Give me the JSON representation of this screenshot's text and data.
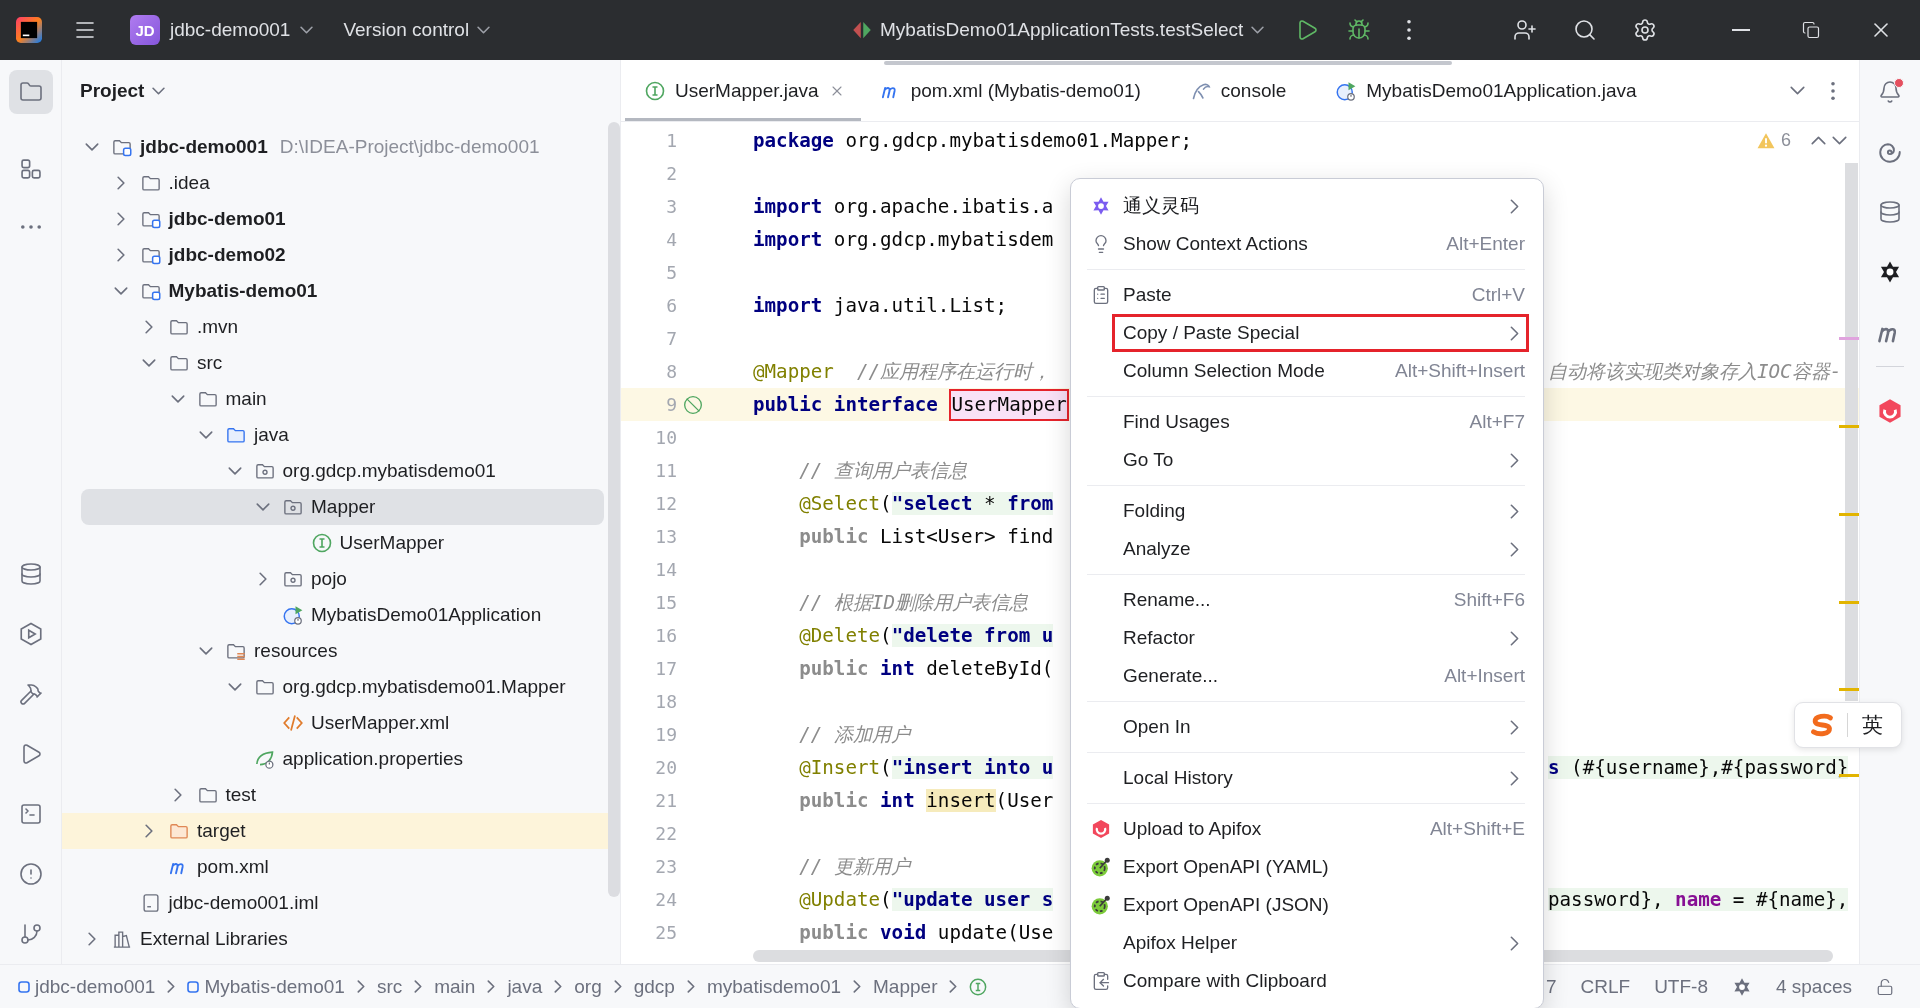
{
  "title_bar": {
    "badge": "JD",
    "project": "jdbc-demo001",
    "vcs": "Version control",
    "run_configuration": "MybatisDemo01ApplicationTests.testSelect"
  },
  "left_toolbar": {
    "top": [
      {
        "kind": "project",
        "selected": true
      },
      {
        "kind": "structure",
        "selected": false
      },
      {
        "kind": "more",
        "selected": false
      }
    ],
    "bottom": [
      {
        "kind": "database",
        "selected": false
      },
      {
        "kind": "services",
        "selected": false
      },
      {
        "kind": "build",
        "selected": false
      },
      {
        "kind": "run",
        "selected": false
      },
      {
        "kind": "terminal",
        "selected": false
      },
      {
        "kind": "problems",
        "selected": false
      },
      {
        "kind": "git",
        "selected": false
      }
    ]
  },
  "project_panel": {
    "title": "Project",
    "tree": [
      {
        "label": "jdbc-demo001",
        "detail": "D:\\IDEA-Project\\jdbc-demo001",
        "kind": "module",
        "expanded": true,
        "selected": false,
        "children": [
          {
            "label": ".idea",
            "kind": "folder",
            "expanded": false,
            "selected": false
          },
          {
            "label": "jdbc-demo01",
            "kind": "module",
            "expanded": false,
            "selected": false
          },
          {
            "label": "jdbc-demo02",
            "kind": "module",
            "expanded": false,
            "selected": false
          },
          {
            "label": "Mybatis-demo01",
            "kind": "module",
            "expanded": true,
            "selected": false,
            "children": [
              {
                "label": ".mvn",
                "kind": "folder",
                "expanded": false,
                "selected": false
              },
              {
                "label": "src",
                "kind": "folder",
                "expanded": true,
                "selected": false,
                "children": [
                  {
                    "label": "main",
                    "kind": "folder",
                    "expanded": true,
                    "selected": false,
                    "children": [
                      {
                        "label": "java",
                        "kind": "source",
                        "expanded": true,
                        "selected": false,
                        "children": [
                          {
                            "label": "org.gdcp.mybatisdemo01",
                            "kind": "package",
                            "expanded": true,
                            "selected": false,
                            "children": [
                              {
                                "label": "Mapper",
                                "kind": "package",
                                "expanded": true,
                                "selected": true,
                                "children": [
                                  {
                                    "label": "UserMapper",
                                    "kind": "interface",
                                    "selected": false
                                  }
                                ]
                              },
                              {
                                "label": "pojo",
                                "kind": "package",
                                "expanded": false,
                                "selected": false
                              },
                              {
                                "label": "MybatisDemo01Application",
                                "kind": "application",
                                "selected": false
                              }
                            ]
                          }
                        ]
                      },
                      {
                        "label": "resources",
                        "kind": "resources",
                        "expanded": true,
                        "selected": false,
                        "children": [
                          {
                            "label": "org.gdcp.mybatisdemo01.Mapper",
                            "kind": "folder",
                            "expanded": true,
                            "selected": false,
                            "children": [
                              {
                                "label": "UserMapper.xml",
                                "kind": "xml",
                                "selected": false
                              }
                            ]
                          },
                          {
                            "label": "application.properties",
                            "kind": "properties",
                            "selected": false
                          }
                        ]
                      }
                    ]
                  },
                  {
                    "label": "test",
                    "kind": "folder",
                    "expanded": false,
                    "selected": false
                  }
                ]
              },
              {
                "label": "target",
                "kind": "excluded",
                "expanded": false,
                "selected": false
              },
              {
                "label": "pom.xml",
                "kind": "maven",
                "selected": false
              }
            ]
          },
          {
            "label": "jdbc-demo001.iml",
            "kind": "iml",
            "selected": false
          }
        ]
      },
      {
        "label": "External Libraries",
        "kind": "libraries",
        "expanded": false,
        "selected": false
      }
    ]
  },
  "editor_tabs": [
    {
      "label": "UserMapper.java",
      "kind": "interface",
      "selected": true,
      "closable": true
    },
    {
      "label": "pom.xml (Mybatis-demo01)",
      "kind": "maven",
      "selected": false,
      "closable": false
    },
    {
      "label": "console",
      "kind": "console",
      "selected": false,
      "closable": false
    },
    {
      "label": "MybatisDemo01Application.java",
      "kind": "application",
      "selected": false,
      "closable": false
    }
  ],
  "editor": {
    "warnings": "6",
    "lines": [
      {
        "number": "1",
        "current": false,
        "indented": false,
        "gutter_mark": false,
        "tokens": [
          {
            "text": "package",
            "kind": "keyword"
          },
          {
            "text": " org.gdcp.mybatisdemo01.Mapper;",
            "kind": "plain"
          }
        ]
      },
      {
        "number": "2",
        "current": false,
        "gutter_mark": false
      },
      {
        "number": "3",
        "current": false,
        "indented": false,
        "gutter_mark": false,
        "tokens": [
          {
            "text": "import",
            "kind": "keyword"
          },
          {
            "text": " org.apache.ibatis.a",
            "kind": "plain"
          }
        ]
      },
      {
        "number": "4",
        "current": false,
        "indented": false,
        "gutter_mark": false,
        "tokens": [
          {
            "text": "import",
            "kind": "keyword"
          },
          {
            "text": " org.gdcp.mybatisdem",
            "kind": "plain"
          }
        ]
      },
      {
        "number": "5",
        "current": false,
        "gutter_mark": false
      },
      {
        "number": "6",
        "current": false,
        "indented": false,
        "gutter_mark": false,
        "tokens": [
          {
            "text": "import",
            "kind": "keyword"
          },
          {
            "text": " java.util.List;",
            "kind": "plain"
          }
        ]
      },
      {
        "number": "7",
        "current": false,
        "gutter_mark": false
      },
      {
        "number": "8",
        "current": false,
        "indented": false,
        "gutter_mark": false,
        "tokens": [
          {
            "text": "@Mapper",
            "kind": "annotation"
          },
          {
            "text": "  //应用程序在运行时，",
            "kind": "comment"
          }
        ],
        "tail": [
          {
            "text": "自动将该实现类对象存入IOC容器-",
            "kind": "comment"
          }
        ]
      },
      {
        "number": "9",
        "current": true,
        "indented": false,
        "gutter_mark": true,
        "tokens": [
          {
            "text": "public",
            "kind": "keyword"
          },
          {
            "text": " interface ",
            "kind": "keyword"
          },
          {
            "text": "UserMapper",
            "kind": "boxed"
          }
        ]
      },
      {
        "number": "10",
        "current": false,
        "gutter_mark": false
      },
      {
        "number": "11",
        "current": false,
        "indented": true,
        "gutter_mark": false,
        "tokens": [
          {
            "text": "// 查询用户表信息",
            "kind": "comment"
          }
        ]
      },
      {
        "number": "12",
        "current": false,
        "indented": true,
        "gutter_mark": false,
        "tokens": [
          {
            "text": "@Select",
            "kind": "annotation"
          },
          {
            "text": "(",
            "kind": "plain"
          },
          {
            "text": "\"select",
            "kind": "sql-keyword"
          },
          {
            "text": " * ",
            "kind": "sql"
          },
          {
            "text": "from",
            "kind": "sql-keyword"
          }
        ]
      },
      {
        "number": "13",
        "current": false,
        "indented": true,
        "gutter_mark": false,
        "tokens": [
          {
            "text": "public",
            "kind": "redundant"
          },
          {
            "text": " List<User> find",
            "kind": "plain"
          }
        ]
      },
      {
        "number": "14",
        "current": false,
        "gutter_mark": false
      },
      {
        "number": "15",
        "current": false,
        "indented": true,
        "gutter_mark": false,
        "tokens": [
          {
            "text": "// 根据ID删除用户表信息",
            "kind": "comment"
          }
        ]
      },
      {
        "number": "16",
        "current": false,
        "indented": true,
        "gutter_mark": false,
        "tokens": [
          {
            "text": "@Delete",
            "kind": "annotation"
          },
          {
            "text": "(",
            "kind": "plain"
          },
          {
            "text": "\"delete from u",
            "kind": "sql-keyword"
          }
        ]
      },
      {
        "number": "17",
        "current": false,
        "indented": true,
        "gutter_mark": false,
        "tokens": [
          {
            "text": "public",
            "kind": "redundant"
          },
          {
            "text": " int",
            "kind": "keyword"
          },
          {
            "text": " deleteById(",
            "kind": "plain"
          }
        ]
      },
      {
        "number": "18",
        "current": false,
        "gutter_mark": false
      },
      {
        "number": "19",
        "current": false,
        "indented": true,
        "gutter_mark": false,
        "tokens": [
          {
            "text": "// 添加用户",
            "kind": "comment"
          }
        ]
      },
      {
        "number": "20",
        "current": false,
        "indented": true,
        "gutter_mark": false,
        "tokens": [
          {
            "text": "@Insert",
            "kind": "annotation"
          },
          {
            "text": "(",
            "kind": "plain"
          },
          {
            "text": "\"insert into u",
            "kind": "sql-keyword"
          }
        ],
        "tail": [
          {
            "text": "s",
            "kind": "sql-keyword"
          },
          {
            "text": " (#{username},#{password}",
            "kind": "sql"
          }
        ]
      },
      {
        "number": "21",
        "current": false,
        "indented": true,
        "gutter_mark": false,
        "tokens": [
          {
            "text": "public",
            "kind": "redundant"
          },
          {
            "text": " int ",
            "kind": "keyword"
          },
          {
            "text": "insert",
            "kind": "usage"
          },
          {
            "text": "(User",
            "kind": "plain"
          }
        ]
      },
      {
        "number": "22",
        "current": false,
        "gutter_mark": false
      },
      {
        "number": "23",
        "current": false,
        "indented": true,
        "gutter_mark": false,
        "tokens": [
          {
            "text": "// 更新用户",
            "kind": "comment"
          }
        ]
      },
      {
        "number": "24",
        "current": false,
        "indented": true,
        "gutter_mark": false,
        "tokens": [
          {
            "text": "@Update",
            "kind": "annotation"
          },
          {
            "text": "(",
            "kind": "plain"
          },
          {
            "text": "\"update user s",
            "kind": "sql-keyword"
          }
        ],
        "tail": [
          {
            "text": "password}, ",
            "kind": "sql"
          },
          {
            "text": "name",
            "kind": "sql-field"
          },
          {
            "text": " = #{name},",
            "kind": "sql"
          }
        ]
      },
      {
        "number": "25",
        "current": false,
        "indented": true,
        "gutter_mark": false,
        "tokens": [
          {
            "text": "public",
            "kind": "redundant"
          },
          {
            "text": " void",
            "kind": "keyword"
          },
          {
            "text": " update(Use",
            "kind": "plain"
          }
        ]
      }
    ]
  },
  "right_toolbar": {
    "notifications_unread": true
  },
  "context_menu": {
    "groups": [
      {
        "items": [
          {
            "label": "通义灵码",
            "kind": "assistant",
            "submenu": true,
            "boxed": false
          },
          {
            "label": "Show Context Actions",
            "kind": "intention",
            "shortcut": "Alt+Enter",
            "submenu": false,
            "boxed": false
          }
        ]
      },
      {
        "items": [
          {
            "label": "Paste",
            "kind": "paste",
            "shortcut": "Ctrl+V",
            "submenu": false,
            "boxed": false
          },
          {
            "label": "Copy / Paste Special",
            "kind": "plain",
            "submenu": true,
            "boxed": true
          },
          {
            "label": "Column Selection Mode",
            "kind": "plain",
            "shortcut": "Alt+Shift+Insert",
            "submenu": false,
            "boxed": false
          }
        ]
      },
      {
        "items": [
          {
            "label": "Find Usages",
            "kind": "plain",
            "shortcut": "Alt+F7",
            "submenu": false,
            "boxed": false
          },
          {
            "label": "Go To",
            "kind": "plain",
            "submenu": true,
            "boxed": false
          }
        ]
      },
      {
        "items": [
          {
            "label": "Folding",
            "kind": "plain",
            "submenu": true,
            "boxed": false
          },
          {
            "label": "Analyze",
            "kind": "plain",
            "submenu": true,
            "boxed": false
          }
        ]
      },
      {
        "items": [
          {
            "label": "Rename...",
            "kind": "plain",
            "shortcut": "Shift+F6",
            "submenu": false,
            "boxed": false
          },
          {
            "label": "Refactor",
            "kind": "plain",
            "submenu": true,
            "boxed": false
          },
          {
            "label": "Generate...",
            "kind": "plain",
            "shortcut": "Alt+Insert",
            "submenu": false,
            "boxed": false
          }
        ]
      },
      {
        "items": [
          {
            "label": "Open In",
            "kind": "plain",
            "submenu": true,
            "boxed": false
          }
        ]
      },
      {
        "items": [
          {
            "label": "Local History",
            "kind": "plain",
            "submenu": true,
            "boxed": false
          }
        ]
      },
      {
        "items": [
          {
            "label": "Upload to Apifox",
            "kind": "upload",
            "shortcut": "Alt+Shift+E",
            "submenu": false,
            "boxed": false
          },
          {
            "label": "Export OpenAPI (YAML)",
            "kind": "export",
            "submenu": false,
            "boxed": false
          },
          {
            "label": "Export OpenAPI (JSON)",
            "kind": "export",
            "submenu": false,
            "boxed": false
          },
          {
            "label": "Apifox Helper",
            "kind": "plain",
            "submenu": true,
            "boxed": false
          },
          {
            "label": "Compare with Clipboard",
            "kind": "compare",
            "submenu": false,
            "boxed": false
          }
        ]
      }
    ]
  },
  "status_bar": {
    "breadcrumbs": [
      {
        "label": "jdbc-demo001",
        "kind": "module"
      },
      {
        "label": "Mybatis-demo01",
        "kind": "module"
      },
      {
        "label": "src",
        "kind": "folder"
      },
      {
        "label": "main",
        "kind": "folder"
      },
      {
        "label": "java",
        "kind": "folder"
      },
      {
        "label": "org",
        "kind": "folder"
      },
      {
        "label": "gdcp",
        "kind": "folder"
      },
      {
        "label": "mybatisdemo01",
        "kind": "folder"
      },
      {
        "label": "Mapper",
        "kind": "folder"
      },
      {
        "kind": "interface"
      }
    ],
    "items": [
      {
        "kind": "text",
        "label": "7"
      },
      {
        "kind": "text",
        "label": "CRLF"
      },
      {
        "kind": "text",
        "label": "UTF-8"
      },
      {
        "kind": "assistant"
      },
      {
        "kind": "text",
        "label": "4 spaces"
      },
      {
        "kind": "readonly"
      }
    ]
  },
  "ime": {
    "mode": "英"
  }
}
